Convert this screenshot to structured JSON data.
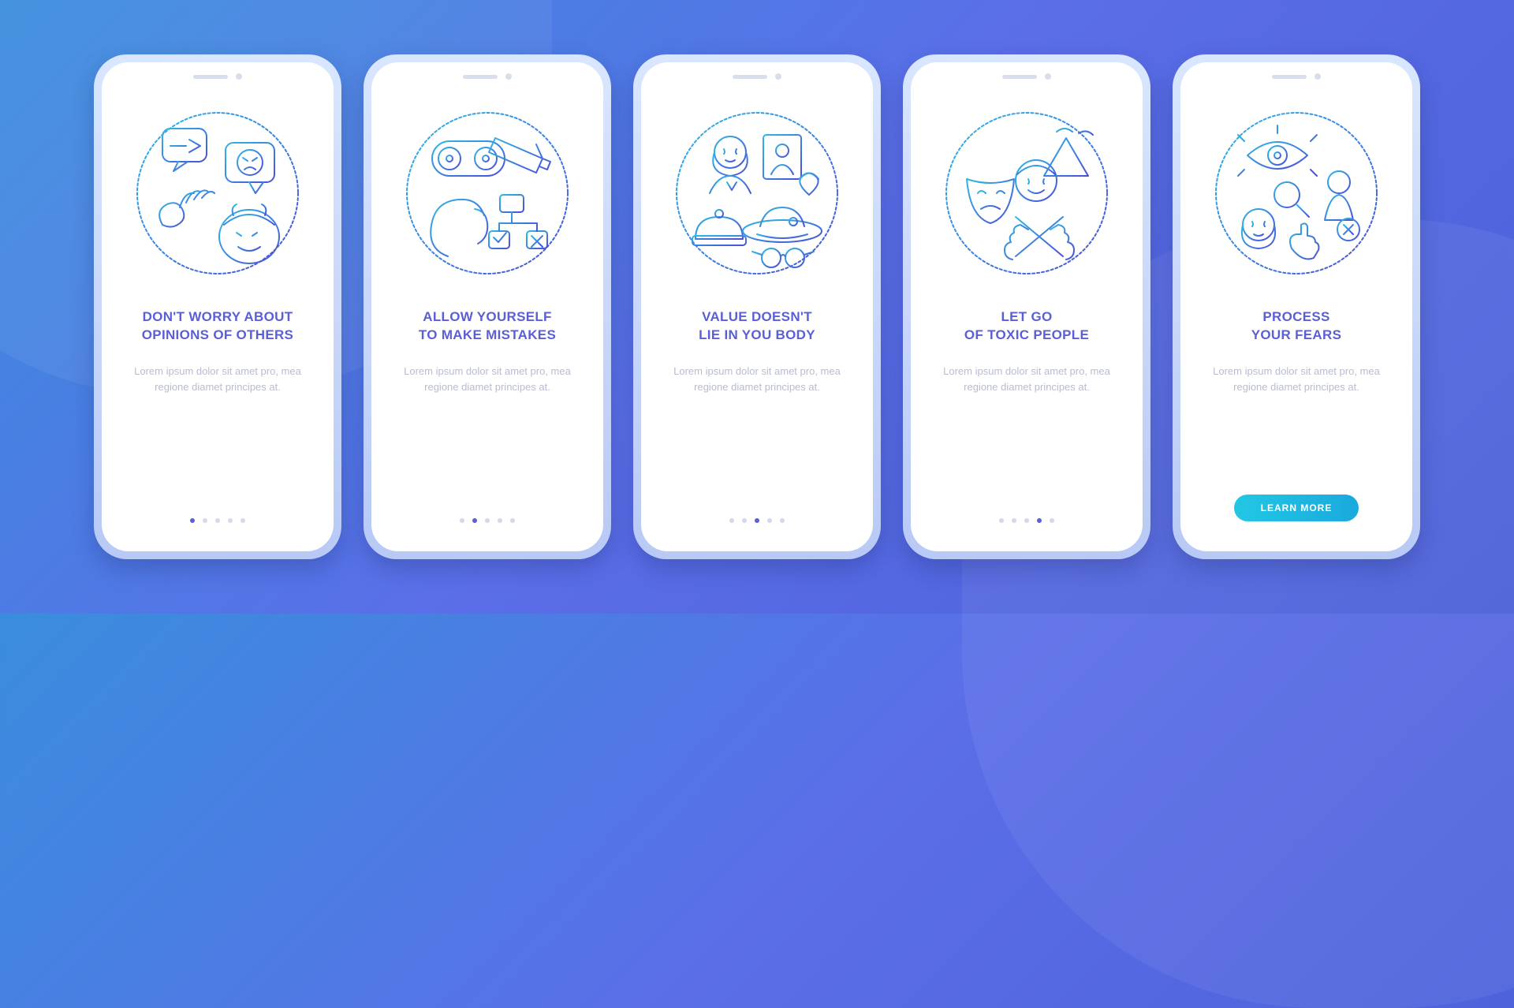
{
  "placeholder_body": "Lorem ipsum dolor sit amet pro, mea regione diamet principes at.",
  "cta_label": "LEARN MORE",
  "total_slides": 5,
  "slides": [
    {
      "title_line1": "DON'T WORRY ABOUT",
      "title_line2": "OPINIONS OF OTHERS",
      "active_index": 0,
      "icon": "opinions-icon"
    },
    {
      "title_line1": "ALLOW YOURSELF",
      "title_line2": "TO MAKE MISTAKES",
      "active_index": 1,
      "icon": "mistakes-icon"
    },
    {
      "title_line1": "VALUE DOESN'T",
      "title_line2": "LIE IN YOU BODY",
      "active_index": 2,
      "icon": "body-value-icon"
    },
    {
      "title_line1": "LET GO",
      "title_line2": "OF TOXIC PEOPLE",
      "active_index": 3,
      "icon": "toxic-people-icon"
    },
    {
      "title_line1": "PROCESS",
      "title_line2": "YOUR FEARS",
      "active_index": 4,
      "icon": "fears-icon"
    }
  ]
}
